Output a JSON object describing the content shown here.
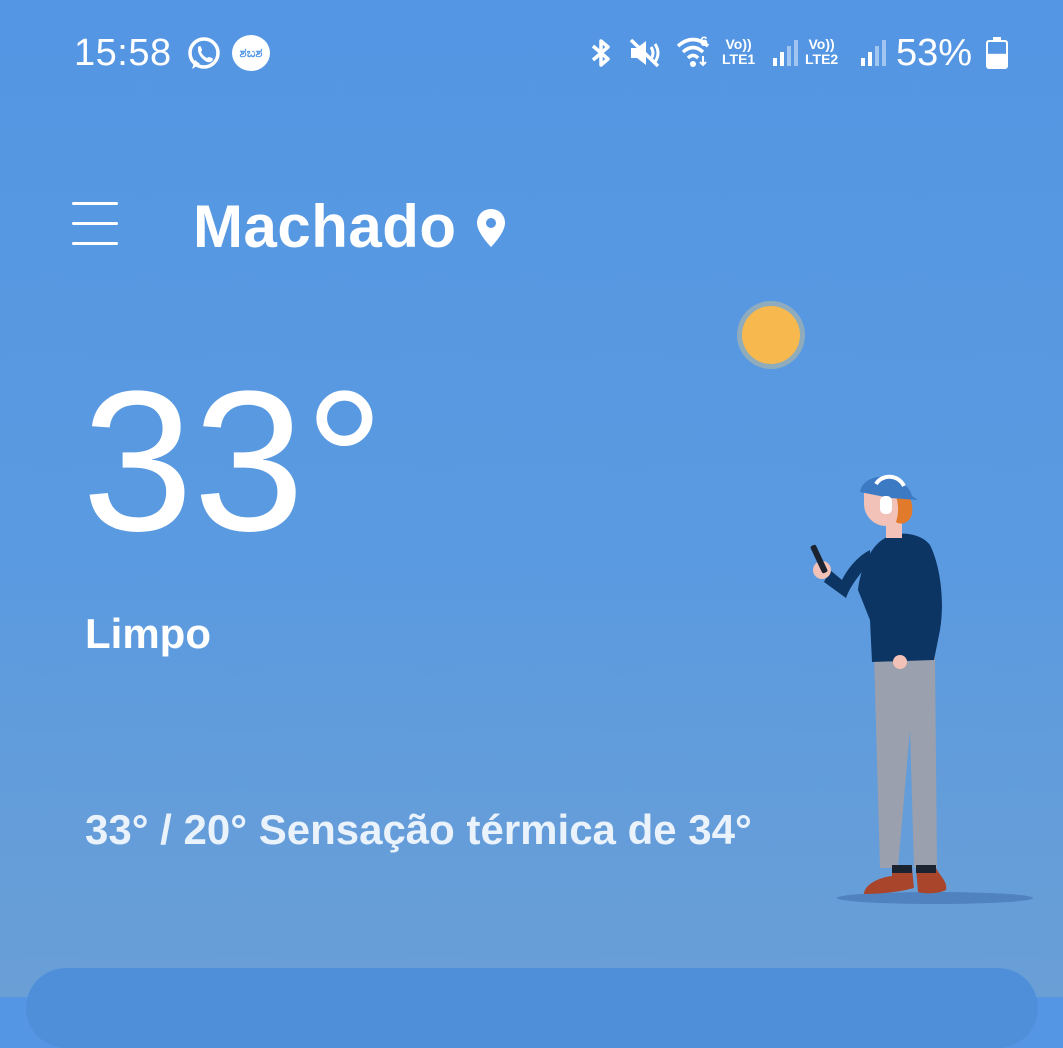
{
  "status_bar": {
    "time": "15:58",
    "notification_icons": [
      "whatsapp-icon",
      "app-badge-icon"
    ],
    "app_badge_text": "ಶಬಶ",
    "system_icons": [
      "bluetooth-icon",
      "vibrate-mute-icon",
      "wifi-icon",
      "signal-icon",
      "signal-icon",
      "battery-icon"
    ],
    "wifi_label": "6",
    "sim1_label": {
      "top": "Vo))",
      "bottom": "LTE1"
    },
    "sim2_label": {
      "top": "Vo))",
      "bottom": "LTE2"
    },
    "battery_percent": "53%",
    "battery_level": 0.53
  },
  "header": {
    "location": "Machado"
  },
  "current": {
    "temperature": "33°",
    "condition": "Limpo",
    "summary": "33° / 20° Sensação térmica de 34°"
  },
  "colors": {
    "background": "#5496e3",
    "sun": "#f7b84d",
    "text": "#ffffff",
    "jacket": "#0d3563",
    "pants": "#9aa0ad",
    "shoes": "#a8452a"
  }
}
